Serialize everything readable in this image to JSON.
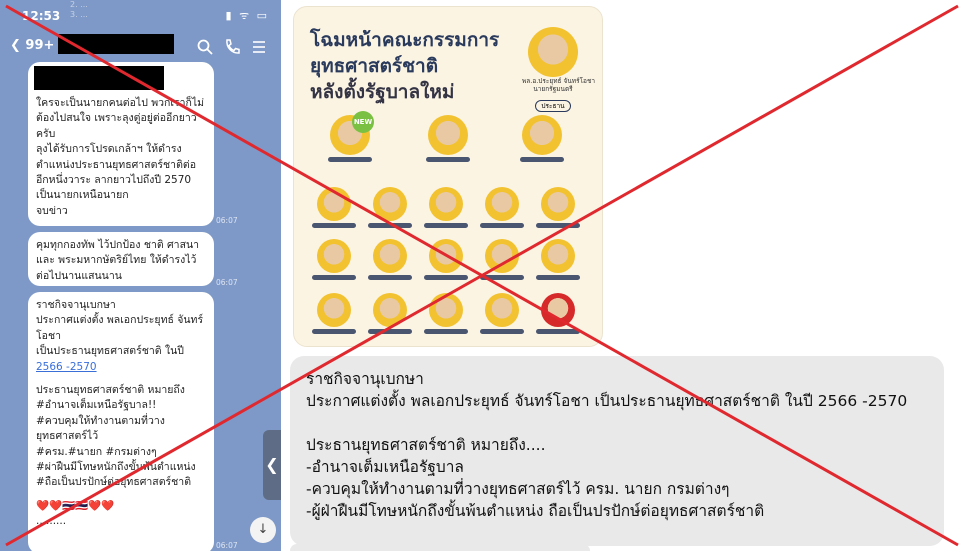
{
  "status_bar": {
    "time": "12:53",
    "icons": "▮ ᯤ ▭"
  },
  "ghost_overlay": [
    "2. ...",
    "3. ..."
  ],
  "chat_header": {
    "back_label": "99+",
    "search_icon": "search-icon",
    "call_icon": "phone-icon",
    "menu_icon": "menu-icon"
  },
  "messages": [
    {
      "lines": [
        "ใครจะเป็นนายกคนต่อไป พวกเราก็ไม่",
        "ต้องไปสนใจ เพราะลุงตู่อยู่ต่ออีกยาว",
        "ครับ",
        "ลุงได้รับการโปรดเกล้าฯ ให้ดำรง",
        "ตำแหน่งประธานยุทธศาสตร์ชาติต่อ",
        "อีกหนึ่งวาระ ลากยาวไปถึงปี 2570",
        "เป็นนายกเหนือนายก",
        "จบข่าว"
      ],
      "time": "06:07"
    },
    {
      "lines": [
        "คุมทุกกองทัพ ไว้ปกป้อง ชาติ ศาสนา",
        "และ พระมหากษัตริย์ไทย ให้ดำรงไว้",
        "ต่อไปนานแสนนาน"
      ],
      "time": "06:07"
    },
    {
      "lines": [
        "ราชกิจจานุเบกษา",
        "ประกาศแต่งตั้ง พลเอกประยุทธ์ จันทร์",
        "โอชา",
        "เป็นประธานยุทธศาสตร์ชาติ ในปี"
      ],
      "link": "2566 -2570",
      "lines2": [
        "ประธานยุทธศาสตร์ชาติ หมายถึง",
        "#อำนาจเต็มเหนือรัฐบาล!!",
        "#ควบคุมให้ทำงานตามที่วาง",
        "ยุทธศาสตร์ไว้",
        "#ครม.#นายก #กรมต่างๆ",
        "#ผ่าฝืนมีโทษหนักถึงขั้นพ้นตำแหน่ง",
        "#ถือเป็นปรปักษ์ต่อยุทธศาสตร์ชาติ"
      ],
      "emoji": "❤️❤️🇹🇭🇹🇭❤️❤️",
      "dots": ".........",
      "time": "06:07"
    }
  ],
  "poster": {
    "title_1": "โฉมหน้าคณะกรรมการ",
    "title_2": "ยุทธศาสตร์ชาติ",
    "title_3": "หลังตั้งรัฐบาลใหม่",
    "chair_name": "พล.อ.ประยุทธ์ จันทร์โอชา",
    "chair_role": "นายกรัฐมนตรี",
    "chair_tag": "ประธาน",
    "new_badge": "NEW"
  },
  "main_message": {
    "lines": [
      "ราชกิจจานุเบกษา",
      "ประกาศแต่งตั้ง พลเอกประยุทธ์ จันทร์โอชา เป็นประธานยุทธศาสตร์ชาติ ในปี 2566 -2570",
      "",
      "ประธานยุทธศาสตร์ชาติ หมายถึง....",
      "-อำนาจเต็มเหนือรัฐบาล",
      "-ควบคุมให้ทำงานตามที่วางยุทธศาสตร์ไว้ ครม. นายก กรมต่างๆ",
      "-ผู้ฝ่าฝืนมีโทษหนักถึงขั้นพ้นตำแหน่ง ถือเป็นปรปักษ์ต่อยุทธศาสตร์ชาติ"
    ]
  },
  "colors": {
    "phone_bg": "#7e99c7",
    "cross": "#e0282f",
    "message_bg": "#e9e9ea"
  }
}
